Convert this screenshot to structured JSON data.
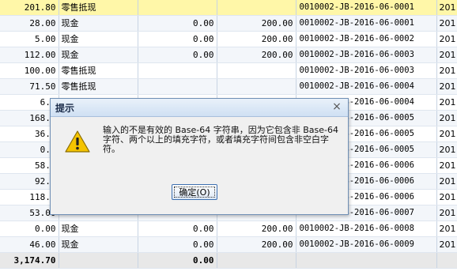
{
  "grid": {
    "rows": [
      [
        "201.80",
        "零售抵现",
        "",
        "",
        "0010002-JB-2016-06-0001",
        "201"
      ],
      [
        "28.00",
        "现金",
        "0.00",
        "200.00",
        "0010002-JB-2016-06-0001",
        "201"
      ],
      [
        "5.00",
        "现金",
        "0.00",
        "200.00",
        "0010002-JB-2016-06-0002",
        "201"
      ],
      [
        "112.00",
        "现金",
        "0.00",
        "200.00",
        "0010002-JB-2016-06-0003",
        "201"
      ],
      [
        "100.00",
        "零售抵现",
        "",
        "",
        "0010002-JB-2016-06-0003",
        "201"
      ],
      [
        "71.50",
        "零售抵现",
        "",
        "",
        "0010002-JB-2016-06-0004",
        "201"
      ],
      [
        "6.0",
        "",
        "",
        "",
        "0010002-JB-2016-06-0004",
        "201"
      ],
      [
        "168.0",
        "",
        "",
        "",
        "0010002-JB-2016-06-0005",
        "201"
      ],
      [
        "36.0",
        "",
        "",
        "",
        "0010002-JB-2016-06-0005",
        "201"
      ],
      [
        "0.0",
        "",
        "",
        "",
        "0010002-JB-2016-06-0005",
        "201"
      ],
      [
        "58.0",
        "",
        "",
        "",
        "0010002-JB-2016-06-0006",
        "201"
      ],
      [
        "92.5",
        "",
        "",
        "",
        "0010002-JB-2016-06-0006",
        "201"
      ],
      [
        "118.0",
        "",
        "",
        "",
        "0010002-JB-2016-06-0006",
        "201"
      ],
      [
        "53.00",
        "",
        "",
        "",
        "0010002-JB-2016-06-0007",
        "201"
      ],
      [
        "0.00",
        "现金",
        "0.00",
        "200.00",
        "0010002-JB-2016-06-0008",
        "201"
      ],
      [
        "46.00",
        "现金",
        "0.00",
        "200.00",
        "0010002-JB-2016-06-0009",
        "201"
      ]
    ],
    "total": [
      "3,174.70",
      "",
      "0.00",
      "",
      "",
      ""
    ]
  },
  "dialog": {
    "title": "提示",
    "close_glyph": "×",
    "message": "输入的不是有效的 Base-64 字符串，因为它包含非 Base-64 字符、两个以上的填充字符，或者填充字符间包含非空白字符。",
    "ok_label": "确定(O)"
  },
  "icons": {
    "dialog_icon": "warning-icon"
  },
  "colors": {
    "selected_row": "#fff7a8",
    "warning_yellow": "#f5c400"
  }
}
